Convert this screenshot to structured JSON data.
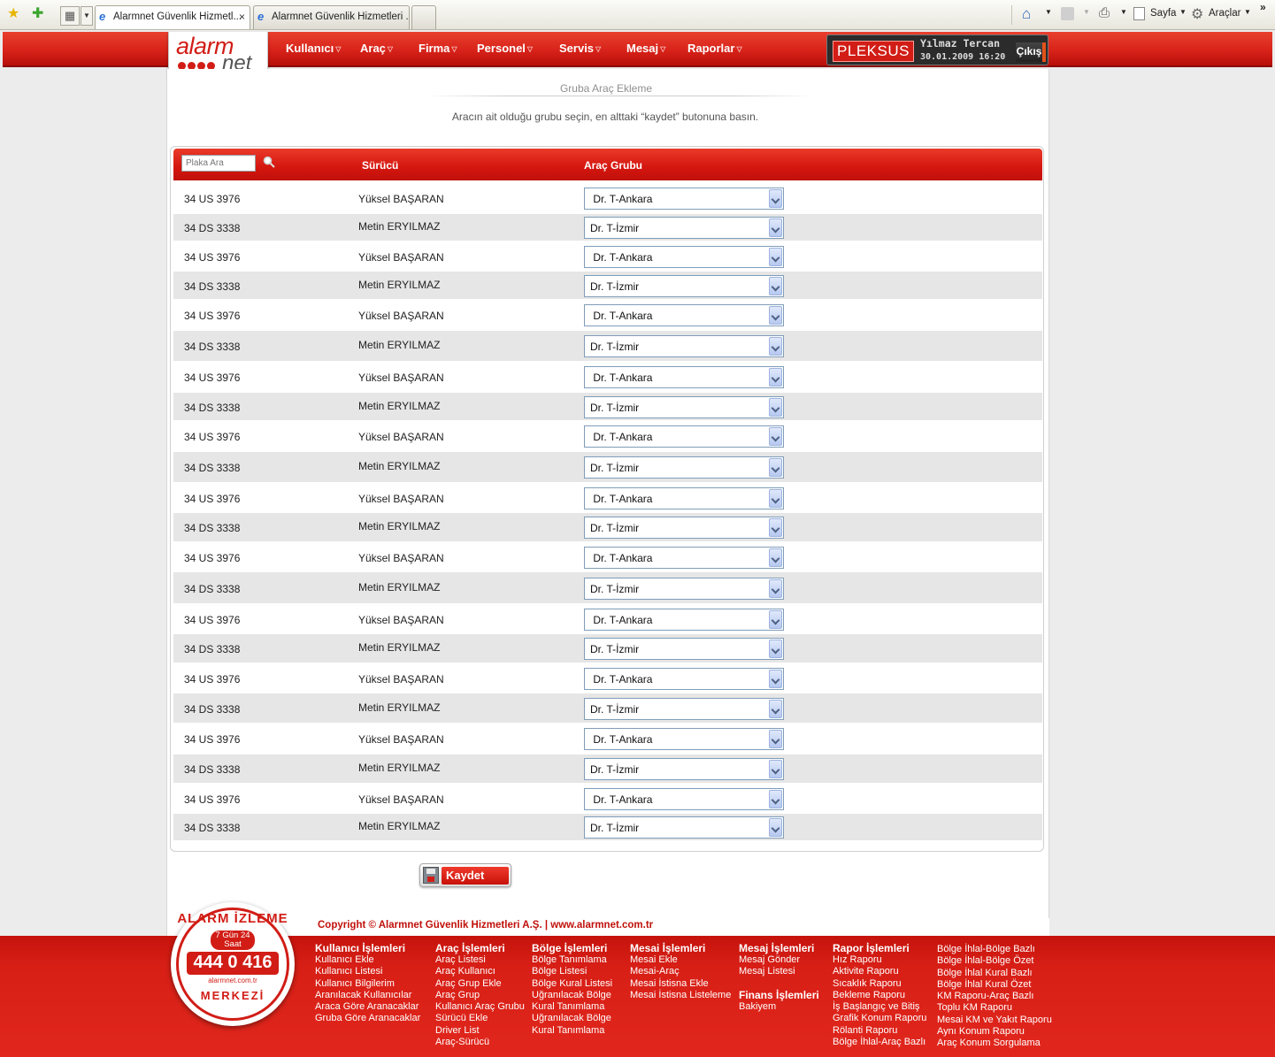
{
  "browser": {
    "tabs": [
      {
        "label": "Alarmnet Güvenlik Hizmetl...",
        "close": "×"
      },
      {
        "label": "Alarmnet Güvenlik Hizmetleri ..."
      }
    ],
    "commands": {
      "page": "Sayfa",
      "tools": "Araçlar"
    },
    "overflow": "»"
  },
  "header": {
    "logo_top": "alarm",
    "logo_bottom": "net",
    "nav": [
      "Kullanıcı",
      "Araç",
      "Firma",
      "Personel",
      "Servis",
      "Mesaj",
      "Raporlar"
    ],
    "user": {
      "brand": "PLEKSUS",
      "name": "Yılmaz Tercan",
      "datetime": "30.01.2009 16:20",
      "logout": "Çıkış"
    }
  },
  "page": {
    "title": "Gruba Araç Ekleme",
    "instructions": "Aracın ait olduğu grubu seçin, en alttaki “kaydet” butonuna basın."
  },
  "table": {
    "search_placeholder": "Plaka Ara",
    "headers": {
      "driver": "Sürücü",
      "group": "Araç Grubu"
    },
    "rows": [
      {
        "plate": "34 US 3976",
        "driver": "Yüksel BAŞARAN",
        "group": " Dr. T-Ankara"
      },
      {
        "plate": "34 DS 3338",
        "driver": "Metin ERYILMAZ",
        "group": "Dr. T-İzmir"
      },
      {
        "plate": "34 US 3976",
        "driver": "Yüksel BAŞARAN",
        "group": " Dr. T-Ankara"
      },
      {
        "plate": "34 DS 3338",
        "driver": "Metin ERYILMAZ",
        "group": "Dr. T-İzmir"
      },
      {
        "plate": "34 US 3976",
        "driver": "Yüksel BAŞARAN",
        "group": " Dr. T-Ankara"
      },
      {
        "plate": "34 DS 3338",
        "driver": "Metin ERYILMAZ",
        "group": "Dr. T-İzmir"
      },
      {
        "plate": "34 US 3976",
        "driver": "Yüksel BAŞARAN",
        "group": " Dr. T-Ankara"
      },
      {
        "plate": "34 DS 3338",
        "driver": "Metin ERYILMAZ",
        "group": "Dr. T-İzmir"
      },
      {
        "plate": "34 US 3976",
        "driver": "Yüksel BAŞARAN",
        "group": " Dr. T-Ankara"
      },
      {
        "plate": "34 DS 3338",
        "driver": "Metin ERYILMAZ",
        "group": "Dr. T-İzmir"
      },
      {
        "plate": "34 US 3976",
        "driver": "Yüksel BAŞARAN",
        "group": " Dr. T-Ankara"
      },
      {
        "plate": "34 DS 3338",
        "driver": "Metin ERYILMAZ",
        "group": "Dr. T-İzmir"
      },
      {
        "plate": "34 US 3976",
        "driver": "Yüksel BAŞARAN",
        "group": " Dr. T-Ankara"
      },
      {
        "plate": "34 DS 3338",
        "driver": "Metin ERYILMAZ",
        "group": "Dr. T-İzmir"
      },
      {
        "plate": "34 US 3976",
        "driver": "Yüksel BAŞARAN",
        "group": " Dr. T-Ankara"
      },
      {
        "plate": "34 DS 3338",
        "driver": "Metin ERYILMAZ",
        "group": "Dr. T-İzmir"
      },
      {
        "plate": "34 US 3976",
        "driver": "Yüksel BAŞARAN",
        "group": " Dr. T-Ankara"
      },
      {
        "plate": "34 DS 3338",
        "driver": "Metin ERYILMAZ",
        "group": "Dr. T-İzmir"
      },
      {
        "plate": "34 US 3976",
        "driver": "Yüksel BAŞARAN",
        "group": " Dr. T-Ankara"
      },
      {
        "plate": "34 DS 3338",
        "driver": "Metin ERYILMAZ",
        "group": "Dr. T-İzmir"
      },
      {
        "plate": "34 US 3976",
        "driver": "Yüksel BAŞARAN",
        "group": " Dr. T-Ankara"
      },
      {
        "plate": "34 DS 3338",
        "driver": "Metin ERYILMAZ",
        "group": "Dr. T-İzmir"
      }
    ]
  },
  "save_label": "Kaydet",
  "footer": {
    "copyright": "Copyright © Alarmnet Güvenlik Hizmetleri A.Ş. | www.alarmnet.com.tr",
    "badge": {
      "top": "ALARM İZLEME",
      "sub": "7 Gün 24 Saat",
      "phone": "444 0 416",
      "url": "alarmnet.com.tr",
      "bottom": "MERKEZİ"
    },
    "columns": [
      {
        "heading": "Kullanıcı İşlemleri",
        "links": [
          "Kullanıcı Ekle",
          "Kullanıcı Listesi",
          "Kullanıcı Bilgilerim",
          "Aranılacak Kullanıcılar",
          "Araca Göre Aranacaklar",
          "Gruba Göre Aranacaklar"
        ]
      },
      {
        "heading": "Araç İşlemleri",
        "links": [
          "Araç Listesi",
          "Araç Kullanıcı",
          "Araç Grup Ekle",
          "Araç Grup",
          "Kullanıcı Araç Grubu",
          "Sürücü Ekle",
          "Driver List",
          "Araç-Sürücü"
        ]
      },
      {
        "heading": "Bölge İşlemleri",
        "links": [
          "Bölge Tanımlama",
          "Bölge Listesi",
          "Bölge Kural Listesi",
          "Uğranılacak Bölge",
          "Kural Tanımlama",
          "Uğranılacak Bölge",
          "Kural Tanımlama"
        ]
      },
      {
        "heading": "Mesai İşlemleri",
        "links": [
          "Mesai Ekle",
          "Mesai-Araç",
          "Mesai İstisna Ekle",
          "Mesai İstisna Listeleme"
        ]
      },
      {
        "heading": "Mesaj İşlemleri",
        "links": [
          "Mesaj Gönder",
          "Mesaj Listesi"
        ],
        "heading2": "Finans İşlemleri",
        "links2": [
          "Bakiyem"
        ]
      },
      {
        "heading": "Rapor İşlemleri",
        "links": [
          "Hız Raporu",
          "Aktivite Raporu",
          "Sıcaklık Raporu",
          "Bekleme Raporu",
          "İş Başlangıç ve Bitiş",
          "Grafik Konum Raporu",
          "Rölanti Raporu",
          "Bölge İhlal-Araç Bazlı"
        ]
      },
      {
        "heading": "",
        "links": [
          "Bölge İhlal-Bölge Bazlı",
          "Bölge İhlal-Bölge Özet",
          "Bölge İhlal Kural Bazlı",
          "Bölge İhlal Kural Özet",
          "KM Raporu-Araç Bazlı",
          "Toplu KM Raporu",
          "Mesai KM ve Yakıt Raporu",
          "Aynı Konum Raporu",
          "Araç Konum Sorgulama"
        ]
      }
    ]
  },
  "colors": {
    "brand_red": "#d11d16",
    "row_alt": "#e6e6e6",
    "select_border": "#7f9db9"
  }
}
